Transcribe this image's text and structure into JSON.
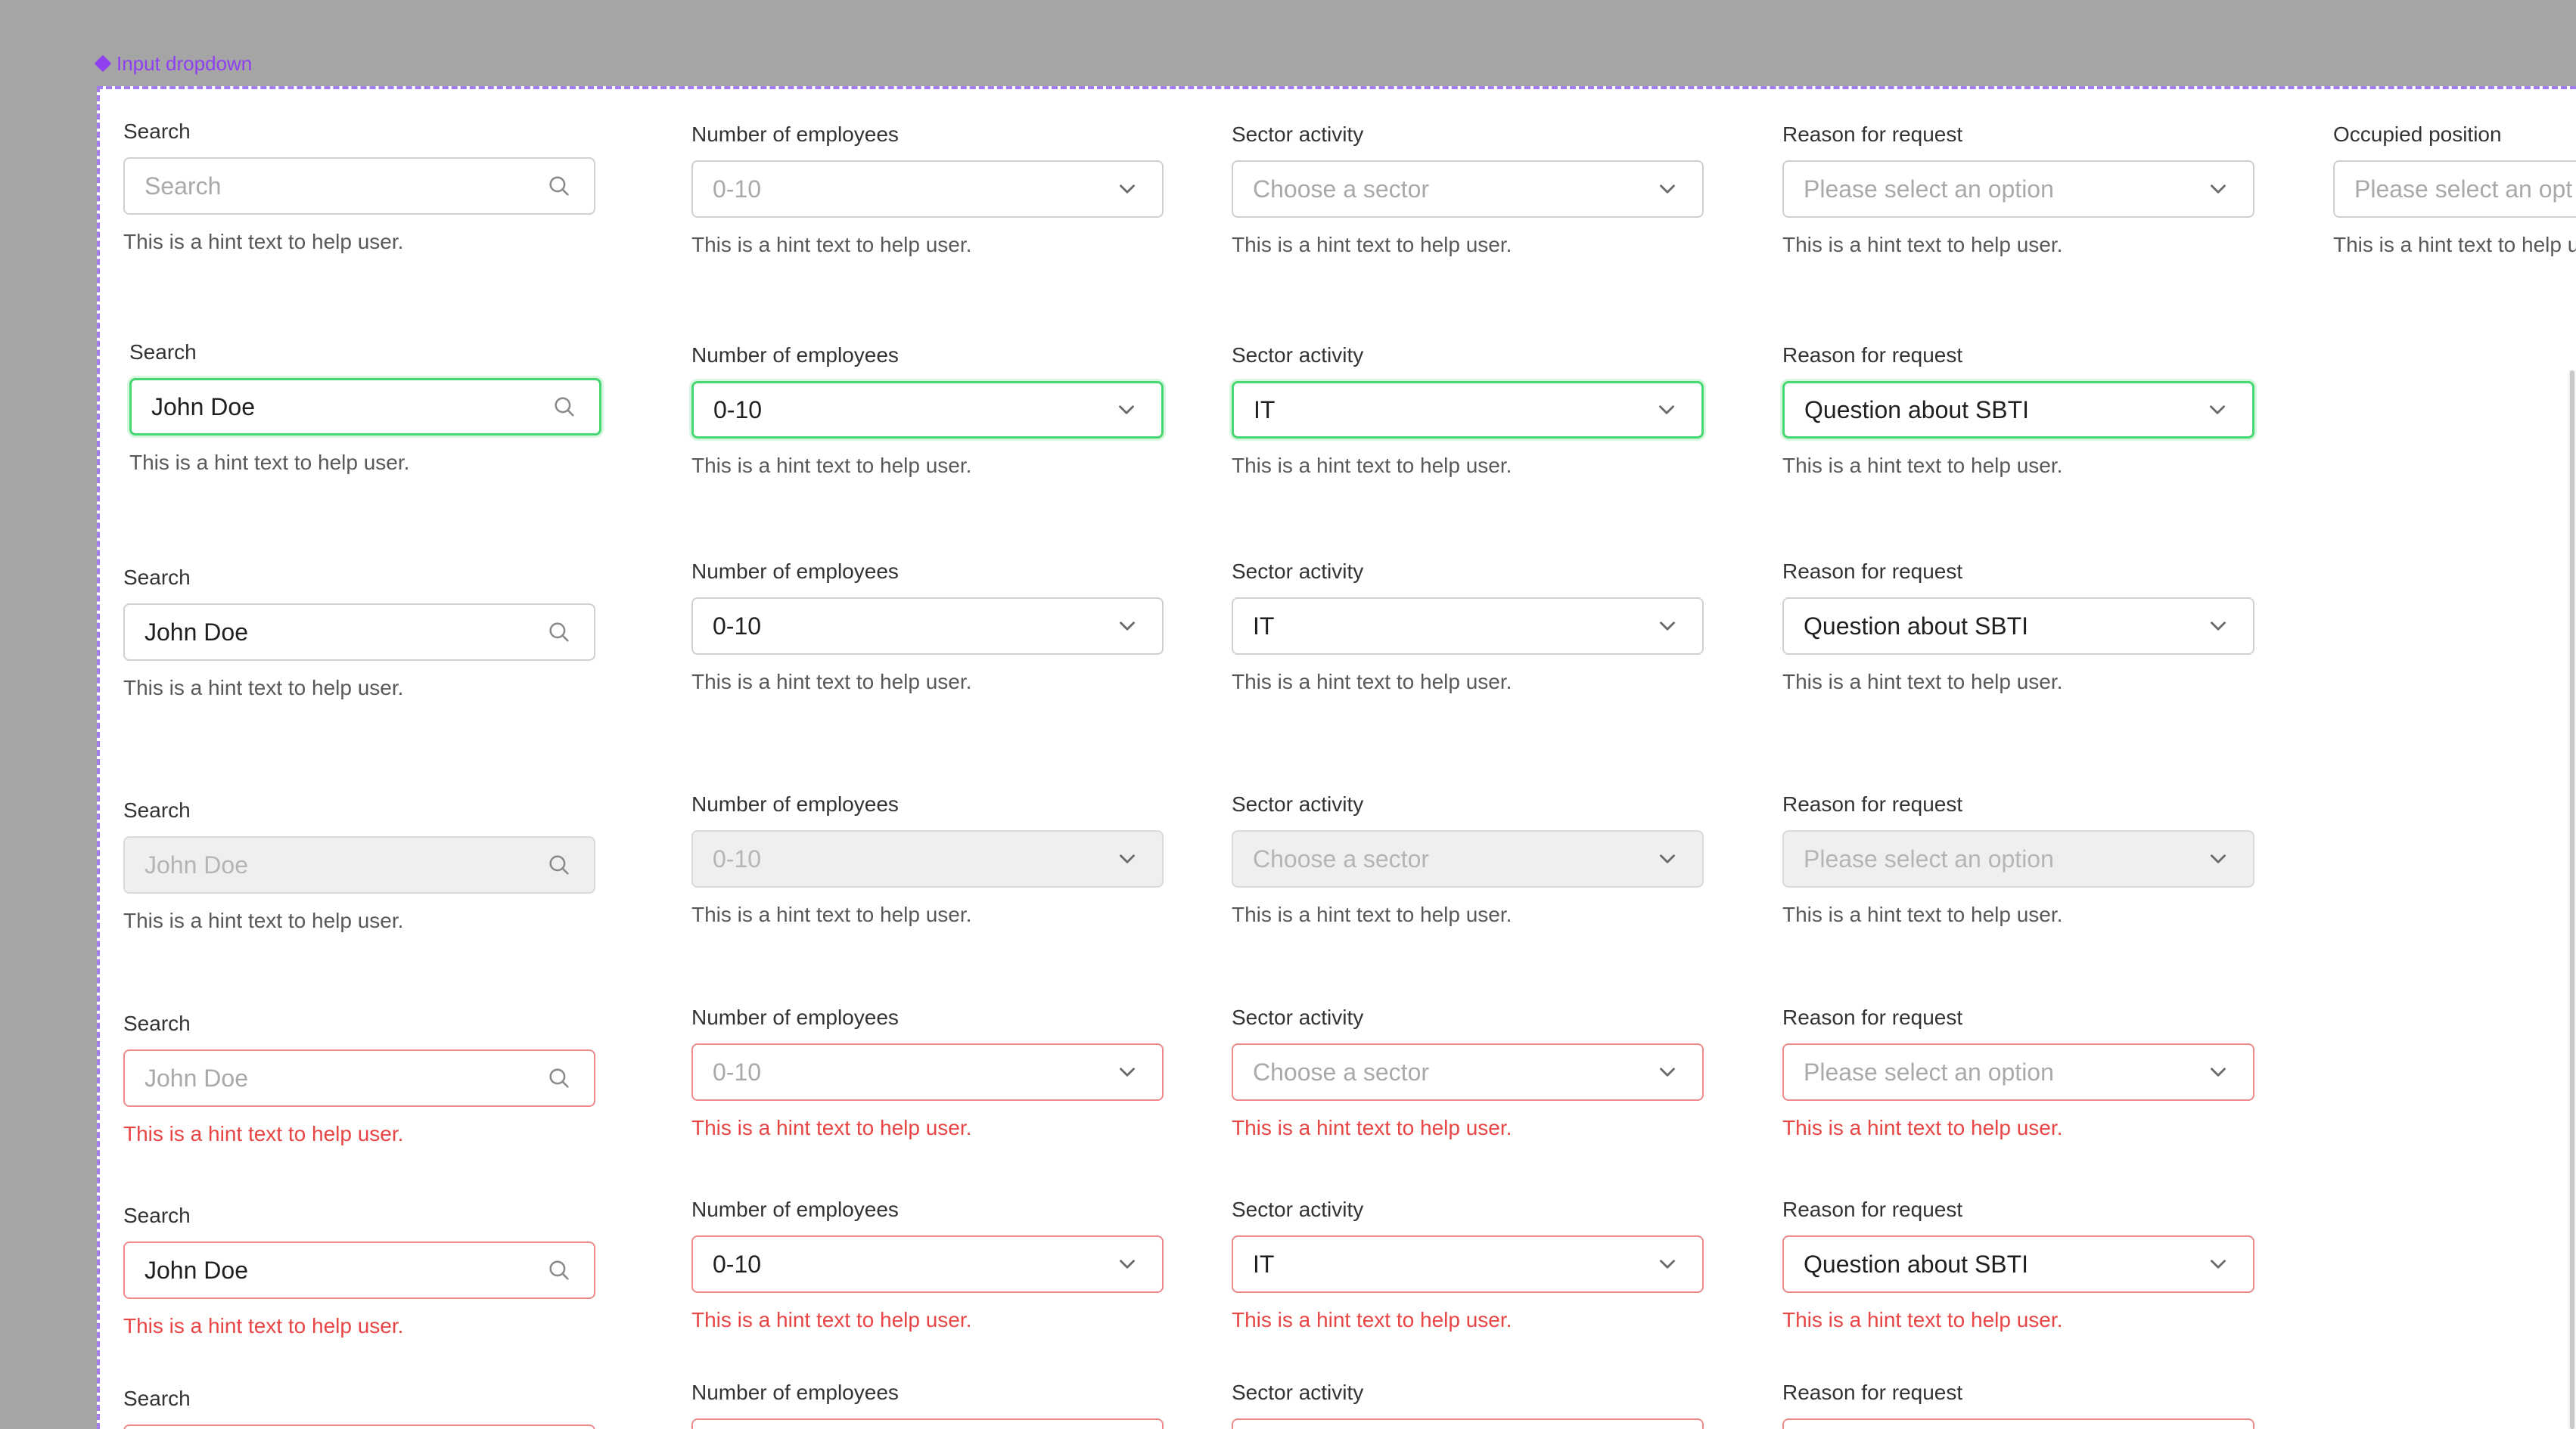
{
  "frame_label": "Input dropdown",
  "colors": {
    "focus": "#47d672",
    "error": "#e84545",
    "accent": "#8e3ff0"
  },
  "icons": {
    "search": "search-icon",
    "dropdown": "chevron-down-icon"
  },
  "hint": "This is a hint text to help user.",
  "columns": {
    "search": "Search",
    "employees": "Number of employees",
    "sector": "Sector activity",
    "reason": "Reason for request",
    "position": "Occupied position"
  },
  "rows": {
    "default": {
      "search": "Search",
      "employees": "0-10",
      "sector": "Choose a sector",
      "reason": "Please select an option",
      "position": "Please select an opt"
    },
    "focused": {
      "search": "John Doe",
      "employees": "0-10",
      "sector": "IT",
      "reason": "Question about SBTI"
    },
    "filled": {
      "search": "John Doe",
      "employees": "0-10",
      "sector": "IT",
      "reason": "Question about SBTI"
    },
    "disabled": {
      "search": "John Doe",
      "employees": "0-10",
      "sector": "Choose a sector",
      "reason": "Please select an option"
    },
    "error": {
      "search": "John Doe",
      "employees": "0-10",
      "sector": "Choose a sector",
      "reason": "Please select an option"
    },
    "error_filled": {
      "search": "John Doe",
      "employees": "0-10",
      "sector": "IT",
      "reason": "Question about SBTI"
    }
  }
}
